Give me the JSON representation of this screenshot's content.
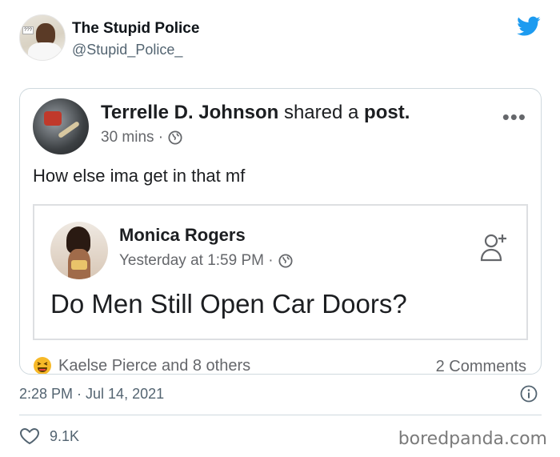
{
  "tweet": {
    "display_name": "The Stupid Police",
    "handle": "@Stupid_Police_",
    "avatar_sign_text": "???",
    "timestamp": "2:28 PM · Jul 14, 2021",
    "likes": "9.1K",
    "brand_color": "#1d9bf0"
  },
  "embedded_post": {
    "author": "Terrelle D. Johnson",
    "action_pre": "shared a",
    "action_object": "post.",
    "time": "30 mins ·",
    "more_glyph": "•••",
    "text": "How else ima get in that mf",
    "shared": {
      "author": "Monica Rogers",
      "time": "Yesterday at 1:59 PM ·",
      "question": "Do Men Still Open Car Doors?"
    },
    "reactions": "Kaelse Pierce and 8 others",
    "comments": "2 Comments"
  },
  "watermark": "boredpanda.com",
  "icons": [
    "twitter-bird-icon",
    "globe-icon",
    "more-options-icon",
    "add-friend-icon",
    "laugh-emoji-icon",
    "info-icon",
    "heart-icon"
  ]
}
